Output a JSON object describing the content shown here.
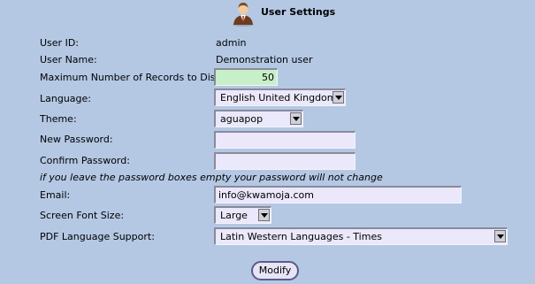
{
  "header": {
    "title": "User Settings",
    "icon": "user-icon"
  },
  "fields": {
    "user_id": {
      "label": "User ID:",
      "value": "admin"
    },
    "user_name": {
      "label": "User Name:",
      "value": "Demonstration user"
    },
    "max_records": {
      "label": "Maximum Number of Records to Display:",
      "value": "50"
    },
    "language": {
      "label": "Language:",
      "value": "English United Kingdom"
    },
    "theme": {
      "label": "Theme:",
      "value": "aguapop"
    },
    "new_password": {
      "label": "New Password:",
      "value": ""
    },
    "confirm_password": {
      "label": "Confirm Password:",
      "value": ""
    },
    "password_note": "if you leave the password boxes empty your password will not change",
    "email": {
      "label": "Email:",
      "value": "info@kwamoja.com"
    },
    "font_size": {
      "label": "Screen Font Size:",
      "value": "Large"
    },
    "pdf_language": {
      "label": "PDF Language Support:",
      "value": "Latin Western Languages - Times"
    }
  },
  "actions": {
    "modify_label": "Modify"
  },
  "colors": {
    "background": "#b4c8e4",
    "input_background": "#eae8fa",
    "numeric_input_background": "#c8f0c8"
  }
}
